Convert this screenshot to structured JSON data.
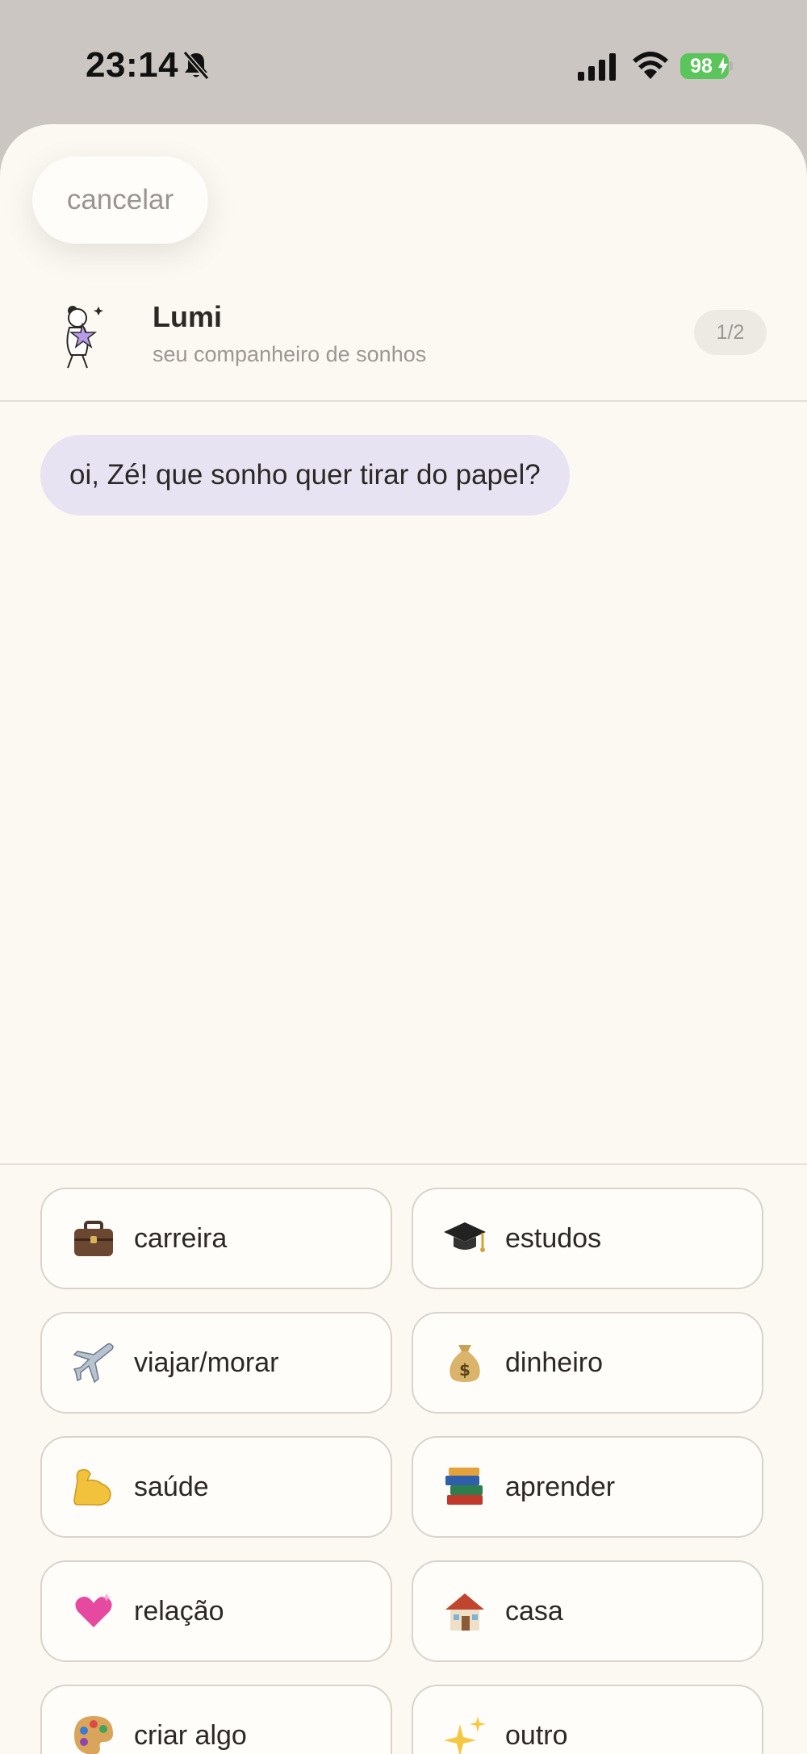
{
  "status_bar": {
    "time": "23:14",
    "battery": "98",
    "icons": [
      "bell-slash-icon",
      "cellular-signal-icon",
      "wifi-icon",
      "battery-charging-icon"
    ]
  },
  "sheet": {
    "cancel_label": "cancelar",
    "companion": {
      "name": "Lumi",
      "subtitle": "seu companheiro de sonhos",
      "step": "1/2"
    },
    "message": "oi, Zé! que sonho quer tirar do papel?",
    "options": [
      {
        "label": "carreira",
        "icon": "briefcase-icon"
      },
      {
        "label": "estudos",
        "icon": "graduation-cap-icon"
      },
      {
        "label": "viajar/morar",
        "icon": "airplane-icon"
      },
      {
        "label": "dinheiro",
        "icon": "money-bag-icon"
      },
      {
        "label": "saúde",
        "icon": "flexed-biceps-icon"
      },
      {
        "label": "aprender",
        "icon": "books-icon"
      },
      {
        "label": "relação",
        "icon": "heart-icon"
      },
      {
        "label": "casa",
        "icon": "house-icon"
      },
      {
        "label": "criar algo",
        "icon": "palette-icon"
      },
      {
        "label": "outro",
        "icon": "sparkles-icon"
      }
    ]
  },
  "colors": {
    "status_bg": "#cbc6c1",
    "sheet_bg": "#fcf8f2",
    "bubble_bg": "#e8e3f3",
    "battery_green": "#5ac55a",
    "option_border": "#d9d3cc"
  }
}
